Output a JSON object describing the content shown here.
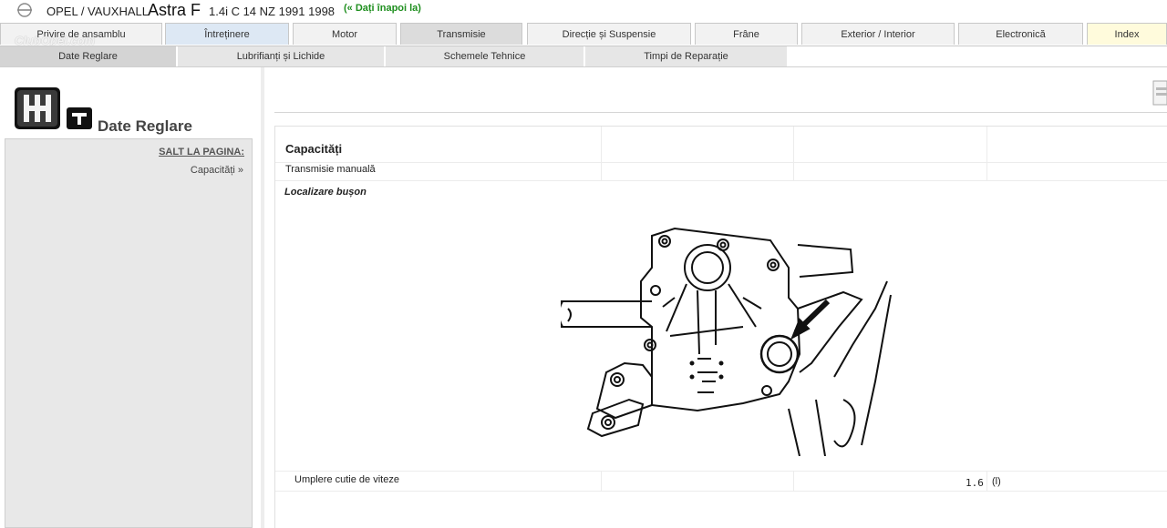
{
  "header": {
    "brand": "OPEL / VAUXHALL",
    "model": "Astra F",
    "spec": "1.4i C 14 NZ 1991 1998",
    "back_link": "(« Dați înapoi la)"
  },
  "watermark": "ClubOpel.com",
  "tabs": [
    {
      "label": "Privire de ansamblu"
    },
    {
      "label": "Întreținere"
    },
    {
      "label": "Motor"
    },
    {
      "label": "Transmisie"
    },
    {
      "label": "Direcție și Suspensie"
    },
    {
      "label": "Frâne"
    },
    {
      "label": "Exterior / Interior"
    },
    {
      "label": "Electronică"
    },
    {
      "label": "Index"
    }
  ],
  "subtabs": [
    {
      "label": "Date Reglare"
    },
    {
      "label": "Lubrifianți și Lichide"
    },
    {
      "label": "Schemele Tehnice"
    },
    {
      "label": "Timpi de Reparație"
    }
  ],
  "sidebar": {
    "title": "Date Reglare",
    "jump_heading": "SALT LA PAGINA:",
    "jump_link": "Capacități »"
  },
  "content": {
    "section_title": "Capacități",
    "subsection": "Transmisie manuală",
    "location_label": "Localizare bușon",
    "fill_label": "Umplere cutie de viteze",
    "fill_value": "1.6",
    "fill_unit": "(l)"
  },
  "icons": {
    "logo": "opel-logo-icon",
    "gear": "gearbox-icon",
    "small": "tool-icon",
    "print": "print-icon"
  }
}
